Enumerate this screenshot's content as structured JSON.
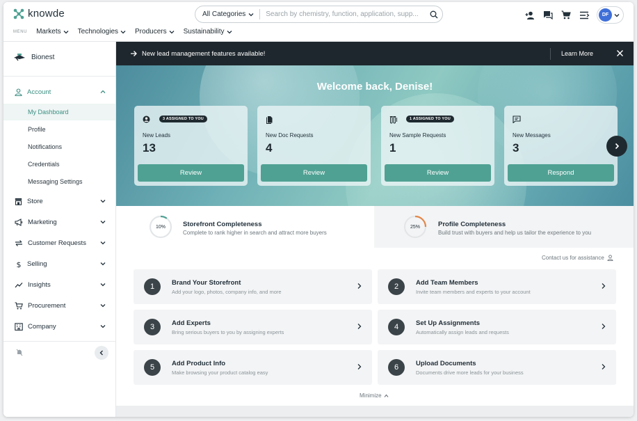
{
  "header": {
    "brand": "knowde",
    "search": {
      "category": "All Categories",
      "placeholder": "Search by chemistry, function, application, supp..."
    },
    "avatar_initials": "DF",
    "menu_tag": "MENU",
    "menu_items": [
      "Markets",
      "Technologies",
      "Producers",
      "Sustainability"
    ]
  },
  "sidebar": {
    "org_name": "Bionest",
    "account_label": "Account",
    "account_subitems": [
      "My Dashboard",
      "Profile",
      "Notifications",
      "Credentials",
      "Messaging Settings"
    ],
    "items": [
      "Store",
      "Marketing",
      "Customer Requests",
      "Selling",
      "Insights",
      "Procurement",
      "Company"
    ]
  },
  "announcement": {
    "message": "New lead management features available!",
    "learn_more": "Learn More"
  },
  "hero": {
    "welcome": "Welcome back, Denise!",
    "cards": [
      {
        "badge": "3 ASSIGNED TO YOU",
        "title": "New Leads",
        "count": "13",
        "button": "Review",
        "icon": "user-circle-icon"
      },
      {
        "badge": "",
        "title": "New Doc Requests",
        "count": "4",
        "button": "Review",
        "icon": "document-icon"
      },
      {
        "badge": "1 ASSIGNED TO YOU",
        "title": "New Sample Requests",
        "count": "1",
        "button": "Review",
        "icon": "test-tube-icon"
      },
      {
        "badge": "",
        "title": "New Messages",
        "count": "3",
        "button": "Respond",
        "icon": "message-icon"
      }
    ]
  },
  "completeness": [
    {
      "percent": "10%",
      "value": 0.1,
      "title": "Storefront Completeness",
      "subtitle": "Complete to rank higher in search and attract more buyers"
    },
    {
      "percent": "25%",
      "value": 0.25,
      "title": "Profile Completeness",
      "subtitle": "Build trust with buyers and help us tailor the experience to you"
    }
  ],
  "contact": "Contact us for assistance",
  "steps": [
    {
      "num": "1",
      "title": "Brand Your Storefront",
      "subtitle": "Add your logo, photos, company info, and more"
    },
    {
      "num": "2",
      "title": "Add Team Members",
      "subtitle": "Invite team members and experts to your account"
    },
    {
      "num": "3",
      "title": "Add Experts",
      "subtitle": "Bring serious buyers to you by assigning experts"
    },
    {
      "num": "4",
      "title": "Set Up Assignments",
      "subtitle": "Automatically assign leads and requests"
    },
    {
      "num": "5",
      "title": "Add Product Info",
      "subtitle": "Make browsing your product catalog easy"
    },
    {
      "num": "6",
      "title": "Upload Documents",
      "subtitle": "Documents drive more leads for your business"
    }
  ],
  "minimize": "Minimize",
  "colors": {
    "accent": "#4fa193",
    "dark": "#1f2a30",
    "ring_teal": "#4fa193",
    "ring_orange": "#e3884a"
  }
}
